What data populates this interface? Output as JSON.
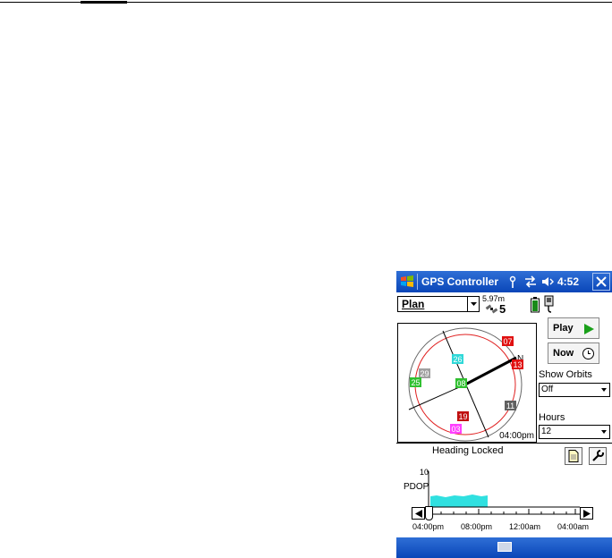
{
  "status_bar": {
    "title": "GPS Controller",
    "time": "4:52"
  },
  "mode_select": {
    "value": "Plan"
  },
  "gps_status": {
    "accuracy": "5.97m",
    "satellites": "5"
  },
  "skyplot": {
    "time": "04:00pm",
    "north_label": "N",
    "satellites": [
      {
        "id": "07",
        "color": "#e01010"
      },
      {
        "id": "26",
        "color": "#30d8d8"
      },
      {
        "id": "13",
        "color": "#e01010"
      },
      {
        "id": "29",
        "color": "#a0a0a0"
      },
      {
        "id": "25",
        "color": "#30c030"
      },
      {
        "id": "08",
        "color": "#30c030"
      },
      {
        "id": "11",
        "color": "#606060"
      },
      {
        "id": "19",
        "color": "#c01010"
      },
      {
        "id": "03",
        "color": "#ff40ff"
      }
    ]
  },
  "controls": {
    "play_label": "Play",
    "now_label": "Now",
    "show_orbits_label": "Show Orbits",
    "show_orbits_value": "Off",
    "hours_label": "Hours",
    "hours_value": "12"
  },
  "heading_text": "Heading Locked",
  "pdop_chart": {
    "ylabel": "PDOP",
    "ymax_label": "10",
    "x_ticks": [
      "04:00pm",
      "08:00pm",
      "12:00am",
      "04:00am"
    ]
  },
  "icons": {
    "windows": "windows-logo-icon",
    "connectivity": "antenna-icon",
    "sync": "sync-arrows-icon",
    "volume": "volume-icon",
    "close": "close-icon",
    "battery": "battery-icon",
    "gps_receiver": "gps-receiver-icon",
    "document": "document-icon",
    "wrench": "wrench-icon",
    "keyboard": "keyboard-icon"
  }
}
